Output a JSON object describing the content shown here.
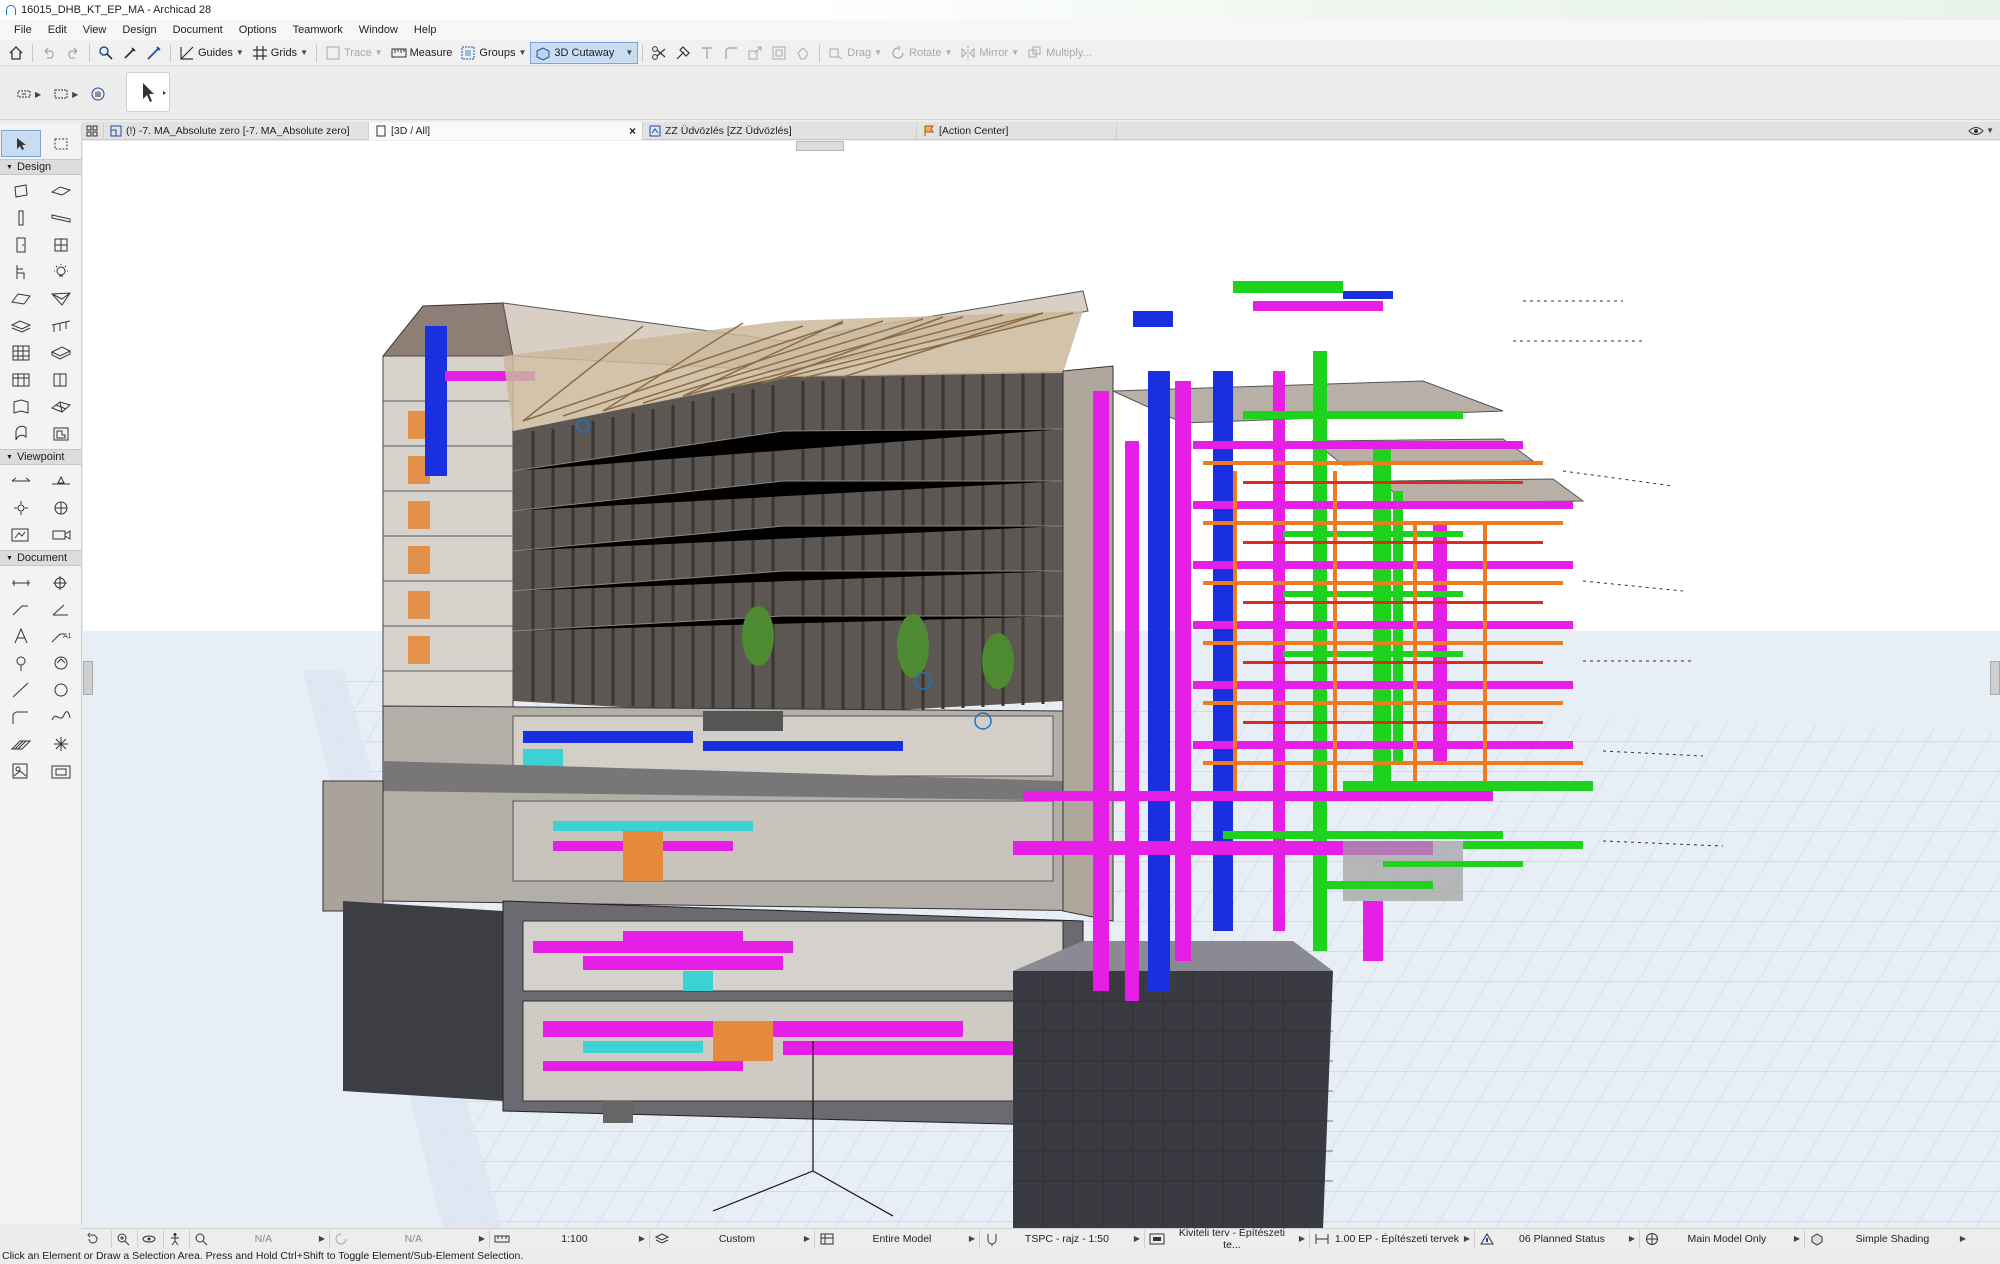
{
  "window": {
    "title": "16015_DHB_KT_EP_MA - Archicad 28"
  },
  "menu": [
    "File",
    "Edit",
    "View",
    "Design",
    "Document",
    "Options",
    "Teamwork",
    "Window",
    "Help"
  ],
  "toolbar": {
    "guides": "Guides",
    "grids": "Grids",
    "trace": "Trace",
    "measure": "Measure",
    "groups": "Groups",
    "cutaway": "3D Cutaway",
    "drag": "Drag",
    "rotate": "Rotate",
    "mirror": "Mirror",
    "multiply": "Multiply..."
  },
  "toolbox": {
    "design": "Design",
    "viewpoint": "Viewpoint",
    "document": "Document"
  },
  "tabs": [
    {
      "label": "(!) -7. MA_Absolute zero [-7. MA_Absolute zero]"
    },
    {
      "label": "[3D / All]"
    },
    {
      "label": "ZZ Üdvözlés [ZZ Üdvözlés]"
    },
    {
      "label": "[Action Center]"
    }
  ],
  "statusbar": {
    "na1": "N/A",
    "na2": "N/A",
    "scale": "1:100",
    "custom": "Custom",
    "model": "Entire Model",
    "pen": "TSPC - rajz - 1:50",
    "mvo": "Kiviteli terv - Építészeti te...",
    "dim": "1.00 EP - Építészeti tervek",
    "status": "06 Planned Status",
    "layer": "Main Model Only",
    "shading": "Simple Shading"
  },
  "hint": "Click an Element or Draw a Selection Area. Press and Hold Ctrl+Shift to Toggle Element/Sub-Element Selection.",
  "colors": {
    "accent": "#1a73c9",
    "pipes_magenta": "#e61fe6",
    "pipes_green": "#1ed21e",
    "ducts_blue": "#1a2fe0",
    "pipes_orange": "#f07a1e",
    "grid": "#cfe0f0"
  }
}
